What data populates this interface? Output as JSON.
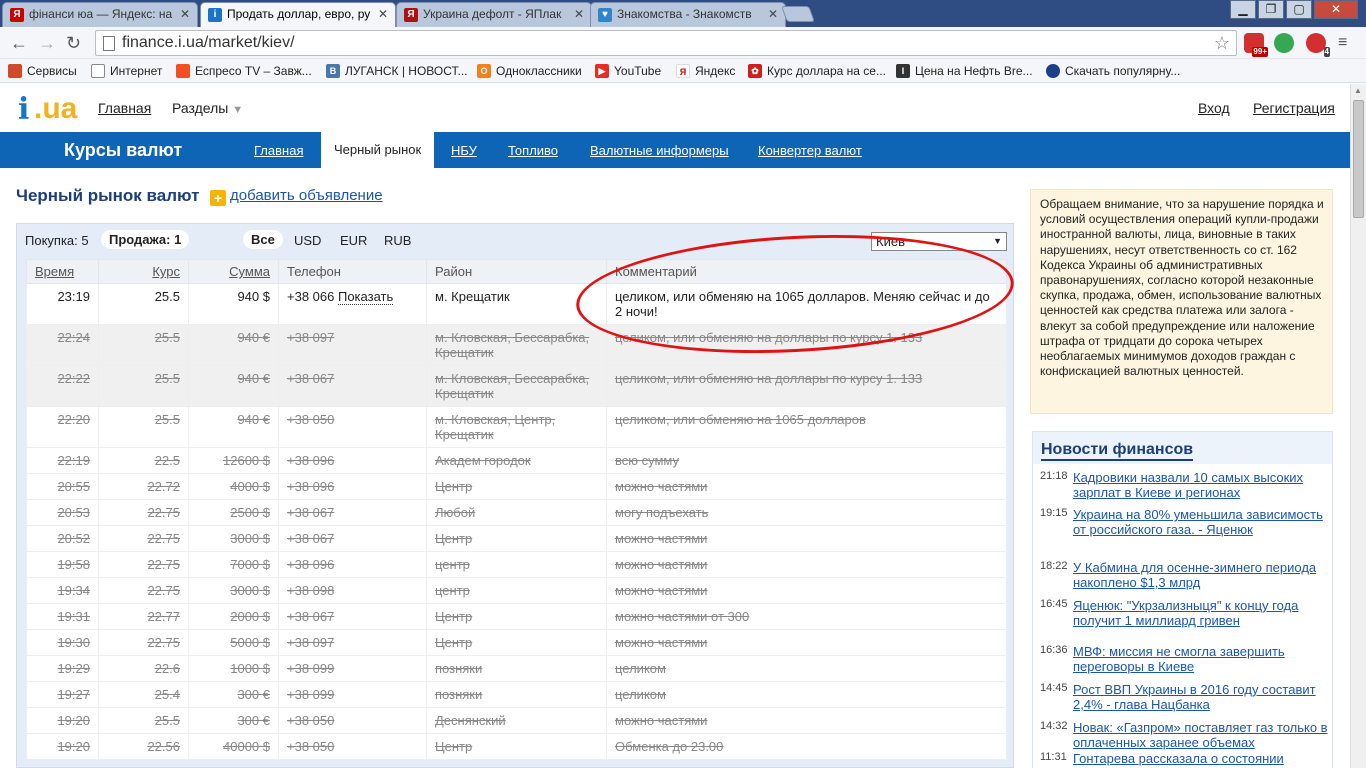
{
  "browser": {
    "tabs": [
      {
        "title": "фінанси юа — Яндекс: на",
        "icon": "yandex-icon",
        "color": "#cc0000"
      },
      {
        "title": "Продать доллар, евро, ру",
        "icon": "iua-icon",
        "color": "#1a74c8"
      },
      {
        "title": "Украина дефолт - ЯПлак",
        "icon": "yaplakal-icon",
        "color": "#b01010"
      },
      {
        "title": "Знакомства - Знакомств",
        "icon": "heart-icon",
        "color": "#2f86c9"
      }
    ],
    "url": "finance.i.ua/market/kiev/",
    "extension_badges": [
      "99+",
      "4"
    ],
    "bookmarks": [
      {
        "label": "Сервисы",
        "icon": "apps-icon",
        "color": "#d04b2a"
      },
      {
        "label": "Интернет",
        "icon": "page-icon",
        "color": "#888888"
      },
      {
        "label": "Еспресо TV – Завж...",
        "icon": "windows-icon",
        "color": "#f25022"
      },
      {
        "label": "ЛУГАНСК | НОВОСТ...",
        "icon": "vk-icon",
        "color": "#4a76a8"
      },
      {
        "label": "Одноклассники",
        "icon": "ok-icon",
        "color": "#f2811d"
      },
      {
        "label": "YouTube",
        "icon": "youtube-icon",
        "color": "#e52d27"
      },
      {
        "label": "Яндекс",
        "icon": "yandex-icon",
        "color": "#cc0000"
      },
      {
        "label": "Курс доллара на се...",
        "icon": "leaf-icon",
        "color": "#cc2020"
      },
      {
        "label": "Цена на Нефть Bre...",
        "icon": "inv-icon",
        "color": "#333333"
      },
      {
        "label": "Скачать популярну...",
        "icon": "globe-icon",
        "color": "#1d3f8a"
      }
    ]
  },
  "site": {
    "logo_i": "i",
    "logo_ua": ".ua",
    "nav_main": "Главная",
    "nav_sections": "Разделы",
    "login": "Вход",
    "register": "Регистрация",
    "bar_title": "Курсы валют",
    "tabs": [
      "Главная",
      "Черный рынок",
      "НБУ",
      "Топливо",
      "Валютные информеры",
      "Конвертер валют"
    ],
    "active_tab": "Черный рынок"
  },
  "market": {
    "title": "Черный рынок валют",
    "add_link": "добавить объявление",
    "buy_label": "Покупка: 5",
    "sell_label": "Продажа: 1",
    "currency_filters": [
      "Все",
      "USD",
      "EUR",
      "RUB"
    ],
    "active_currency": "Все",
    "city": "Киев",
    "columns": [
      "Время",
      "Курс",
      "Сумма",
      "Телефон",
      "Район",
      "Комментарий"
    ],
    "show_label": "Показать",
    "rows": [
      {
        "time": "23:19",
        "rate": "25.5",
        "sum": "940 $",
        "phone": "+38 066",
        "district": "м. Крещатик",
        "comment": "целиком, или обменяю на 1065 долларов. Меняю сейчас и до 2 ночи!"
      },
      {
        "time": "22:24",
        "rate": "25.5",
        "sum": "940 €",
        "phone": "+38 097",
        "district": "м. Кловская, Бессарабка, Крещатик",
        "comment": "целиком, или обменяю на доллары по курсу 1. 133"
      },
      {
        "time": "22:22",
        "rate": "25.5",
        "sum": "940 €",
        "phone": "+38 067",
        "district": "м. Кловская, Бессарабка, Крещатик",
        "comment": "целиком, или обменяю на доллары по курсу 1. 133"
      },
      {
        "time": "22:20",
        "rate": "25.5",
        "sum": "940 €",
        "phone": "+38 050",
        "district": "м. Кловская, Центр, Крещатик",
        "comment": "целиком, или обменяю на 1065 долларов"
      },
      {
        "time": "22:19",
        "rate": "22.5",
        "sum": "12600 $",
        "phone": "+38 096",
        "district": "Академ городок",
        "comment": "всю сумму"
      },
      {
        "time": "20:55",
        "rate": "22.72",
        "sum": "4000 $",
        "phone": "+38 096",
        "district": "Центр",
        "comment": "можно частями"
      },
      {
        "time": "20:53",
        "rate": "22.75",
        "sum": "2500 $",
        "phone": "+38 067",
        "district": "Любой",
        "comment": "могу подъехать"
      },
      {
        "time": "20:52",
        "rate": "22.75",
        "sum": "3000 $",
        "phone": "+38 067",
        "district": "Центр",
        "comment": "можно частями"
      },
      {
        "time": "19:58",
        "rate": "22.75",
        "sum": "7000 $",
        "phone": "+38 096",
        "district": "центр",
        "comment": "можно частями"
      },
      {
        "time": "19:34",
        "rate": "22.75",
        "sum": "3000 $",
        "phone": "+38 098",
        "district": "центр",
        "comment": "можно частями"
      },
      {
        "time": "19:31",
        "rate": "22.77",
        "sum": "2000 $",
        "phone": "+38 067",
        "district": "Центр",
        "comment": "можно частями от 300"
      },
      {
        "time": "19:30",
        "rate": "22.75",
        "sum": "5000 $",
        "phone": "+38 097",
        "district": "Центр",
        "comment": "можно частями"
      },
      {
        "time": "19:29",
        "rate": "22.6",
        "sum": "1000 $",
        "phone": "+38 099",
        "district": "позняки",
        "comment": "целиком"
      },
      {
        "time": "19:27",
        "rate": "25.4",
        "sum": "300 €",
        "phone": "+38 099",
        "district": "позняки",
        "comment": "целиком"
      },
      {
        "time": "19:20",
        "rate": "25.5",
        "sum": "300 €",
        "phone": "+38 050",
        "district": "Деснянский",
        "comment": "можно частями"
      },
      {
        "time": "19:20",
        "rate": "22.56",
        "sum": "40000 $",
        "phone": "+38 050",
        "district": "Центр",
        "comment": "Обменка до 23.00"
      }
    ]
  },
  "notice": "Обращаем внимание, что за нарушение порядка и условий осуществления операций купли-продажи иностранной валюты, лица, виновные в таких нарушениях, несут ответственность со ст. 162 Кодекса Украины об административных правонарушениях, согласно которой незаконные скупка, продажа, обмен, использование валютных ценностей как средства платежа или залога - влекут за собой предупреждение или наложение штрафа от тридцати до сорока четырех необлагаемых минимумов доходов граждан с конфискацией валютных ценностей.",
  "news": {
    "title": "Новости финансов",
    "items": [
      {
        "time": "21:18",
        "title": "Кадровики назвали 10 самых высоких зарплат в Киеве и регионах"
      },
      {
        "time": "19:15",
        "title": "Украина на 80% уменьшила зависимость от российского газа. - Яценюк"
      },
      {
        "time": "18:22",
        "title": "У Кабмина для осенне-зимнего периода накоплено $1,3 млрд"
      },
      {
        "time": "16:45",
        "title": "Яценюк: \"Укрзализныця\" к концу года получит 1 миллиард гривен"
      },
      {
        "time": "16:36",
        "title": "МВФ: миссия не смогла завершить переговоры в Киеве"
      },
      {
        "time": "14:45",
        "title": "Рост ВВП Украины в 2016 году составит 2,4% - глава Нацбанка"
      },
      {
        "time": "14:32",
        "title": "Новак: «Газпром» поставляет газ только в оплаченных заранее объемах"
      },
      {
        "time": "11:31",
        "title": "Гонтарева рассказала о состоянии"
      }
    ]
  }
}
